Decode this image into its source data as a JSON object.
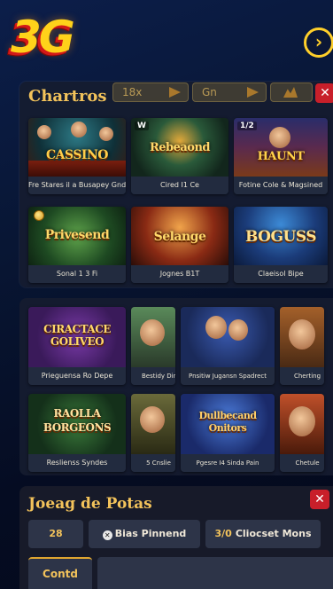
{
  "header": {
    "logo_text": "3G",
    "next_icon": "chevron-right-icon"
  },
  "games_panel": {
    "title": "Chartros",
    "filters": [
      {
        "label": "18x"
      },
      {
        "label": "Gn"
      },
      {
        "label": ""
      }
    ],
    "rows": [
      [
        {
          "title": "CASSINO",
          "caption": "Fre Stares il a Busapey Gnd",
          "badge": ""
        },
        {
          "title": "Rebeaond",
          "caption": "Cired I1 Ce",
          "badge": ""
        },
        {
          "title": "HAUNT",
          "caption": "Fotine Cole & Magsined",
          "badge": "1/2"
        }
      ],
      [
        {
          "title": "Privesend",
          "caption": "Sonal 1 3 Fi",
          "badge": ""
        },
        {
          "title": "Selange",
          "caption": "Jognes B1T",
          "badge": ""
        },
        {
          "title": "BOGUSS",
          "caption": "Claeisol Bipe",
          "badge": ""
        }
      ]
    ]
  },
  "games_panel_2": {
    "rows": [
      [
        {
          "title": "CIRACTACE GOLIVEO",
          "caption": "Prieguensa Ro Depe"
        },
        {
          "title": "",
          "caption": "Bestidy Dinue"
        },
        {
          "title": "",
          "caption": "Pnsitiw Jugansn Spadrect"
        },
        {
          "title": "",
          "caption": "Cherting"
        }
      ],
      [
        {
          "title": "RAOLLA BORGEONS",
          "caption": "Reslienss Syndes"
        },
        {
          "title": "",
          "caption": "5 Cnslie"
        },
        {
          "title": "Dullbecand Onitors",
          "caption": "Pgesre I4 Sinda Pain"
        },
        {
          "title": "",
          "caption": "Chetule"
        }
      ]
    ]
  },
  "bottom_panel": {
    "title": "Joeag de Potas",
    "options": [
      {
        "label": "28"
      },
      {
        "label": "Bias Pinnend"
      },
      {
        "label": "Cliocset Mons",
        "prefix": "3/0"
      }
    ],
    "confirm_label": "Contd"
  },
  "colors": {
    "accent": "#f3c35b",
    "close": "#c81f2a",
    "logo": "#ffd21a"
  }
}
